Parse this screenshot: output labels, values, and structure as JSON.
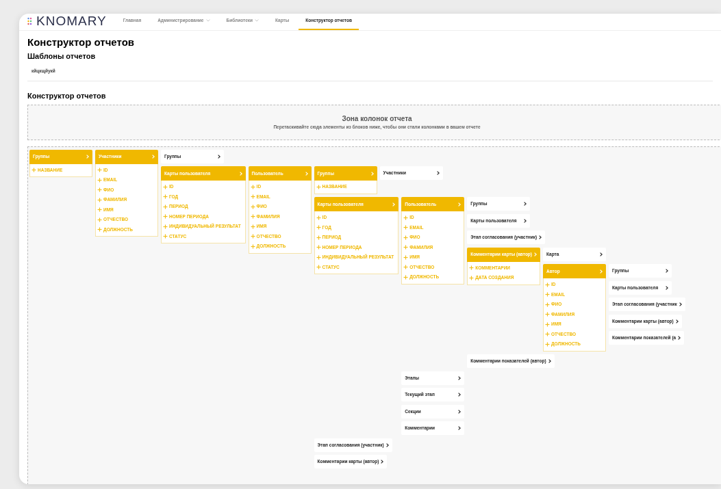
{
  "logo": "KNOMARY",
  "nav": [
    {
      "label": "Главная",
      "dropdown": false,
      "selected": false
    },
    {
      "label": "Администрирование",
      "dropdown": true,
      "selected": false
    },
    {
      "label": "Библиотеки",
      "dropdown": true,
      "selected": false
    },
    {
      "label": "Карты",
      "dropdown": false,
      "selected": false
    },
    {
      "label": "Конструктор отчетов",
      "dropdown": false,
      "selected": true
    }
  ],
  "page_title": "Конструктор отчетов",
  "templates": {
    "title": "Шаблоны отчетов",
    "items": [
      "кйцкщйукй"
    ]
  },
  "builder": {
    "title": "Конструктор отчетов",
    "drop_zone": {
      "title": "Зона колонок отчета",
      "hint": "Перетаскивайте сюда элементы из блоков ниже, чтобы они стали колонками в вашем отчете"
    },
    "tree": [
      {
        "label": "Группы",
        "expanded": true,
        "fields": [
          "НАЗВАНИЕ"
        ],
        "children": [
          {
            "label": "Участники",
            "expanded": true,
            "fields": [
              "ID",
              "EMAIL",
              "ФИО",
              "ФАМИЛИЯ",
              "ИМЯ",
              "ОТЧЕСТВО",
              "ДОЛЖНОСТЬ"
            ],
            "children": [
              {
                "label": "Группы",
                "expanded": false
              },
              {
                "label": "Карты пользователя",
                "expanded": true,
                "fields": [
                  "ID",
                  "ГОД",
                  "ПЕРИОД",
                  "НОМЕР ПЕРИОДА",
                  "ИНДИВИДУАЛЬНЫЙ РЕЗУЛЬТАТ",
                  "СТАТУС"
                ],
                "children": [
                  {
                    "label": "Пользователь",
                    "expanded": true,
                    "fields": [
                      "ID",
                      "EMAIL",
                      "ФИО",
                      "ФАМИЛИЯ",
                      "ИМЯ",
                      "ОТЧЕСТВО",
                      "ДОЛЖНОСТЬ"
                    ],
                    "children": [
                      {
                        "label": "Группы",
                        "expanded": true,
                        "fields": [
                          "НАЗВАНИЕ"
                        ],
                        "children": [
                          {
                            "label": "Участники",
                            "expanded": false
                          }
                        ]
                      },
                      {
                        "label": "Карты пользователя",
                        "expanded": true,
                        "fields": [
                          "ID",
                          "ГОД",
                          "ПЕРИОД",
                          "НОМЕР ПЕРИОДА",
                          "ИНДИВИДУАЛЬНЫЙ РЕЗУЛЬТАТ",
                          "СТАТУС"
                        ],
                        "children": [
                          {
                            "label": "Пользователь",
                            "expanded": true,
                            "fields": [
                              "ID",
                              "EMAIL",
                              "ФИО",
                              "ФАМИЛИЯ",
                              "ИМЯ",
                              "ОТЧЕСТВО",
                              "ДОЛЖНОСТЬ"
                            ],
                            "children": [
                              {
                                "label": "Группы",
                                "expanded": false
                              },
                              {
                                "label": "Карты пользователя",
                                "expanded": false
                              },
                              {
                                "label": "Этап согласования (участник)",
                                "expanded": false
                              },
                              {
                                "label": "Комментарии карты (автор)",
                                "expanded": true,
                                "fields": [
                                  "КОММЕНТАРИИ",
                                  "ДАТА СОЗДАНИЯ"
                                ],
                                "children": [
                                  {
                                    "label": "Карта",
                                    "expanded": false
                                  },
                                  {
                                    "label": "Автор",
                                    "expanded": true,
                                    "fields": [
                                      "ID",
                                      "EMAIL",
                                      "ФИО",
                                      "ФАМИЛИЯ",
                                      "ИМЯ",
                                      "ОТЧЕСТВО",
                                      "ДОЛЖНОСТЬ"
                                    ],
                                    "children": [
                                      {
                                        "label": "Группы",
                                        "expanded": false
                                      },
                                      {
                                        "label": "Карты пользователя",
                                        "expanded": false
                                      },
                                      {
                                        "label": "Этап согласования (участник",
                                        "expanded": false
                                      },
                                      {
                                        "label": "Комментарии карты (автор)",
                                        "expanded": false
                                      },
                                      {
                                        "label": "Комментарии показателей (а",
                                        "expanded": false
                                      }
                                    ]
                                  }
                                ]
                              },
                              {
                                "label": "Комментарии показателей (автор)",
                                "expanded": false
                              }
                            ]
                          },
                          {
                            "label": "Этапы",
                            "expanded": false
                          },
                          {
                            "label": "Текущий этап",
                            "expanded": false
                          },
                          {
                            "label": "Секции",
                            "expanded": false
                          },
                          {
                            "label": "Комментарии",
                            "expanded": false
                          }
                        ]
                      },
                      {
                        "label": "Этап согласования (участник)",
                        "expanded": false
                      },
                      {
                        "label": "Комментарии карты (автор)",
                        "expanded": false
                      }
                    ]
                  }
                ]
              }
            ]
          }
        ]
      }
    ]
  }
}
